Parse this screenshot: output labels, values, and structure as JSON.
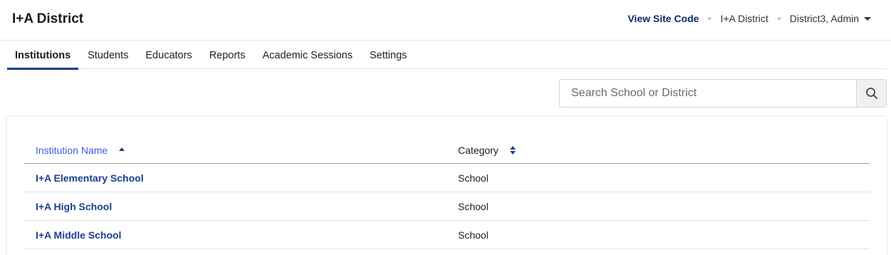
{
  "app": {
    "title": "I+A District"
  },
  "header": {
    "site_code_label": "View Site Code",
    "district_name": "I+A District",
    "user_label": "District3, Admin"
  },
  "tabs": [
    {
      "label": "Institutions",
      "active": true
    },
    {
      "label": "Students"
    },
    {
      "label": "Educators"
    },
    {
      "label": "Reports"
    },
    {
      "label": "Academic Sessions"
    },
    {
      "label": "Settings"
    }
  ],
  "search": {
    "placeholder": "Search School or District"
  },
  "table": {
    "columns": {
      "name": "Institution Name",
      "category": "Category"
    },
    "rows": [
      {
        "name": "I+A Elementary School",
        "category": "School"
      },
      {
        "name": "I+A High School",
        "category": "School"
      },
      {
        "name": "I+A Middle School",
        "category": "School"
      }
    ]
  },
  "colors": {
    "accent": "#1b3f8f",
    "link_header": "#3b5bdb",
    "site_code": "#0a2a66"
  },
  "icons": {
    "search": "search-icon",
    "user_menu": "chevron-down-icon",
    "sort_asc": "sort-ascending-icon",
    "sort_both": "sort-icon"
  }
}
